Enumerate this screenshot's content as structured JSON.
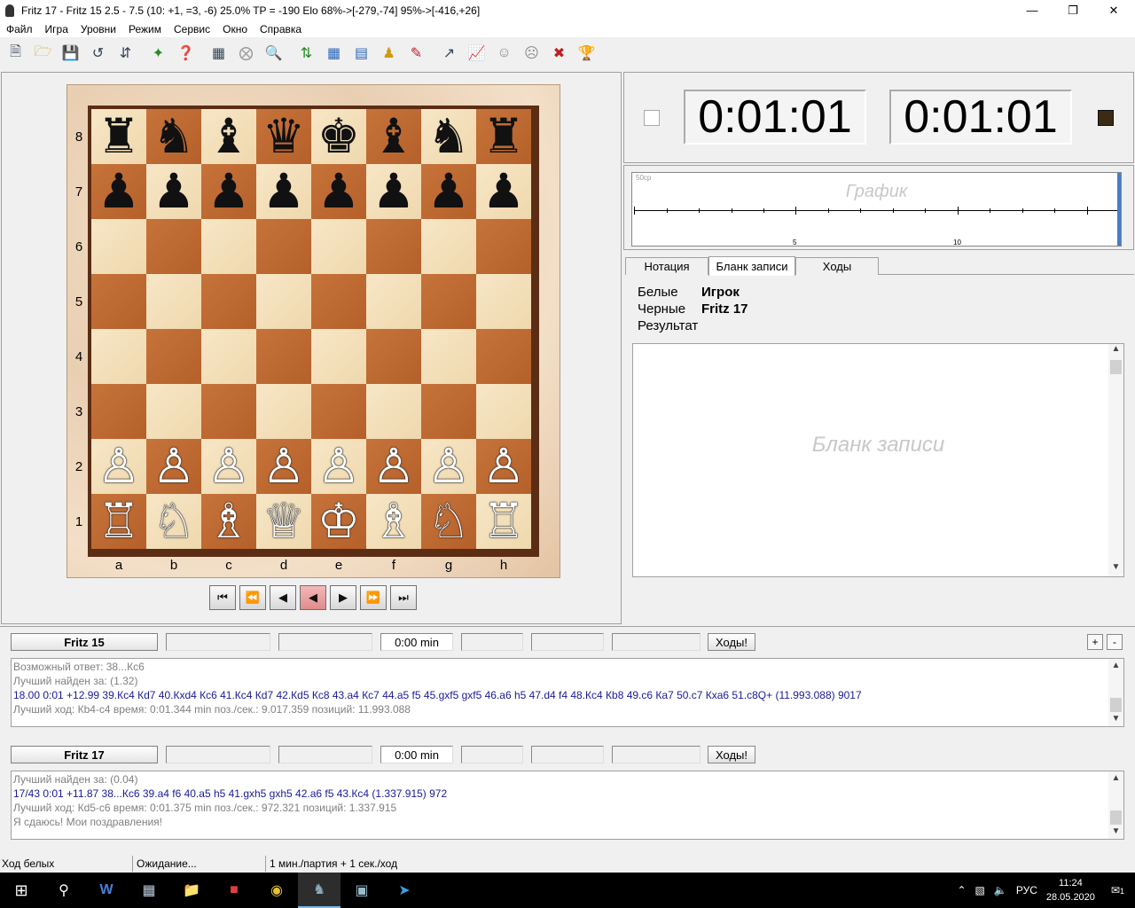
{
  "window": {
    "title": "Fritz 17 - Fritz 15  2.5 - 7.5  (10: +1, =3, -6)  25.0%   TP = -190 Elo    68%->[-279,-74]   95%->[-416,+26]"
  },
  "menu": [
    "Файл",
    "Игра",
    "Уровни",
    "Режим",
    "Сервис",
    "Окно",
    "Справка"
  ],
  "board": {
    "ranks": [
      "8",
      "7",
      "6",
      "5",
      "4",
      "3",
      "2",
      "1"
    ],
    "files": [
      "a",
      "b",
      "c",
      "d",
      "e",
      "f",
      "g",
      "h"
    ],
    "pieces": [
      [
        "♜",
        "♞",
        "♝",
        "♛",
        "♚",
        "♝",
        "♞",
        "♜"
      ],
      [
        "♟",
        "♟",
        "♟",
        "♟",
        "♟",
        "♟",
        "♟",
        "♟"
      ],
      [
        "",
        "",
        "",
        "",
        "",
        "",
        "",
        ""
      ],
      [
        "",
        "",
        "",
        "",
        "",
        "",
        "",
        ""
      ],
      [
        "",
        "",
        "",
        "",
        "",
        "",
        "",
        ""
      ],
      [
        "",
        "",
        "",
        "",
        "",
        "",
        "",
        ""
      ],
      [
        "♙",
        "♙",
        "♙",
        "♙",
        "♙",
        "♙",
        "♙",
        "♙"
      ],
      [
        "♖",
        "♘",
        "♗",
        "♕",
        "♔",
        "♗",
        "♘",
        "♖"
      ]
    ]
  },
  "clocks": {
    "white": "0:01:01",
    "black": "0:01:01"
  },
  "graph": {
    "title": "График",
    "scale": "50cp",
    "ticks": [
      "5",
      "10"
    ]
  },
  "tabs": [
    "Нотация",
    "Бланк записи",
    "Ходы"
  ],
  "game": {
    "white_label": "Белые",
    "white_value": "Игрок",
    "black_label": "Черные",
    "black_value": "Fritz 17",
    "result_label": "Результат"
  },
  "scoresheet": {
    "title": "Бланк записи"
  },
  "engine1": {
    "name": "Fritz 15",
    "time": "0:00 min",
    "move_btn": "Ходы!",
    "lines": [
      "Возможный ответ: 38...Кc6",
      "Лучший найден за: (1.32)",
      "18.00        0:01        +12.99        39.Кc4 Кd7 40.Кxd4 Кc6 41.Кc4 Кd7 42.Кd5 Кc8 43.a4 Кc7 44.a5 f5 45.gxf5 gxf5 46.a6 h5 47.d4 f4 48.Кc4 Кb8 49.c6 Кa7 50.c7 Кxa6 51.c8Q+ (11.993.088) 9017",
      "Лучший ход: Кb4-c4 время: 0:01.344 min  поз./сек.: 9.017.359    позиций: 11.993.088"
    ]
  },
  "engine2": {
    "name": "Fritz 17",
    "time": "0:00 min",
    "move_btn": "Ходы!",
    "lines": [
      "Лучший найден за: (0.04)",
      "17/43        0:01        +11.87        38...Кc6 39.a4 f6 40.a5 h5 41.gxh5 gxh5 42.a6 f5 43.Кc4 (1.337.915) 972",
      "Лучший ход: Кd5-c6 время: 0:01.375 min  поз./сек.: 972.321    позиций: 1.337.915",
      "Я сдаюсь! Мои поздравления!"
    ]
  },
  "status": [
    "Ход белых",
    "Ожидание...",
    "1 мин./партия + 1 сек./ход"
  ],
  "tray": {
    "lang": "РУС",
    "time": "11:24",
    "date": "28.05.2020",
    "notifications": "1"
  },
  "colors": {
    "light_square": "#f7e6c6",
    "dark_square": "#c6733a",
    "board_border": "#5b2d14"
  }
}
